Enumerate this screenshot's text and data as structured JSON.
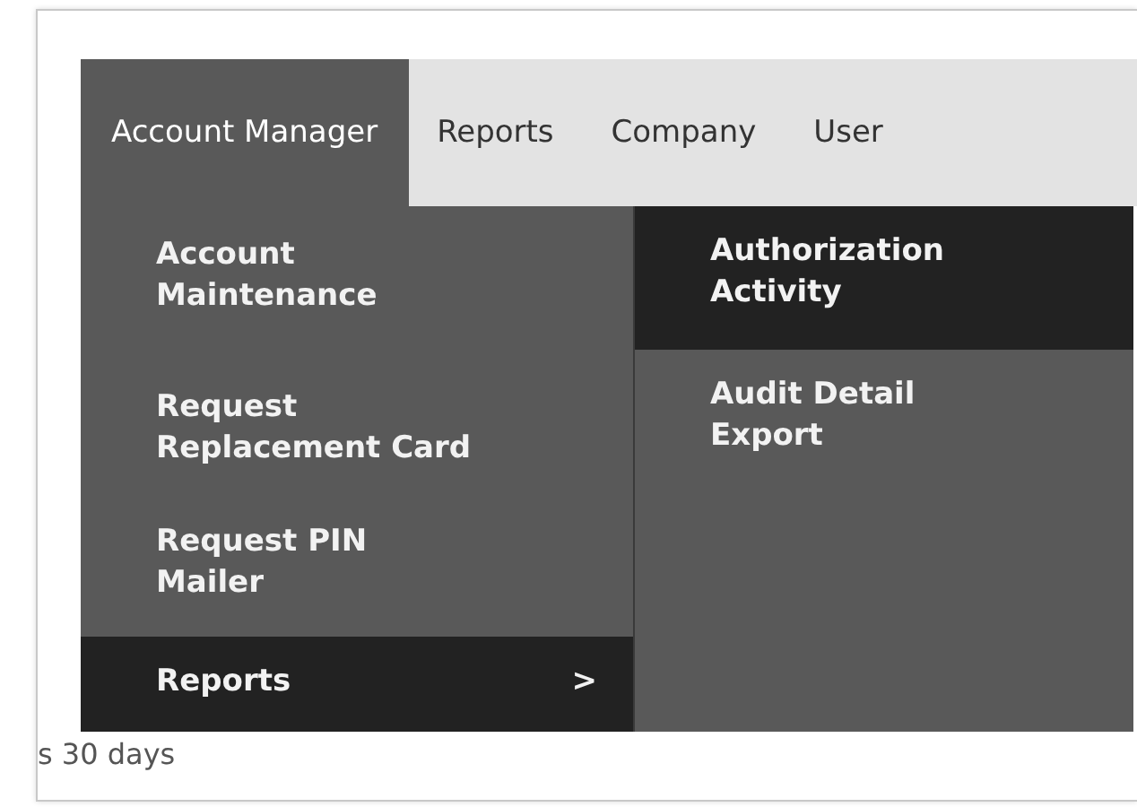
{
  "menubar": [
    {
      "label": "Account Manager",
      "selected": true
    },
    {
      "label": "Reports",
      "selected": false
    },
    {
      "label": "Company",
      "selected": false
    },
    {
      "label": "User",
      "selected": false
    }
  ],
  "dropdown": [
    {
      "label": "Account\nMaintenance",
      "selected": false
    },
    {
      "label": "Request\nReplacement Card",
      "selected": false
    },
    {
      "label": "Request PIN\nMailer",
      "selected": false
    },
    {
      "label": "Reports",
      "selected": true,
      "arrow": ">"
    }
  ],
  "submenu": [
    {
      "label": "Authorization Activity",
      "selected": true
    },
    {
      "label": "Audit Detail Export",
      "selected": false
    }
  ],
  "background_text": "s 30 days"
}
